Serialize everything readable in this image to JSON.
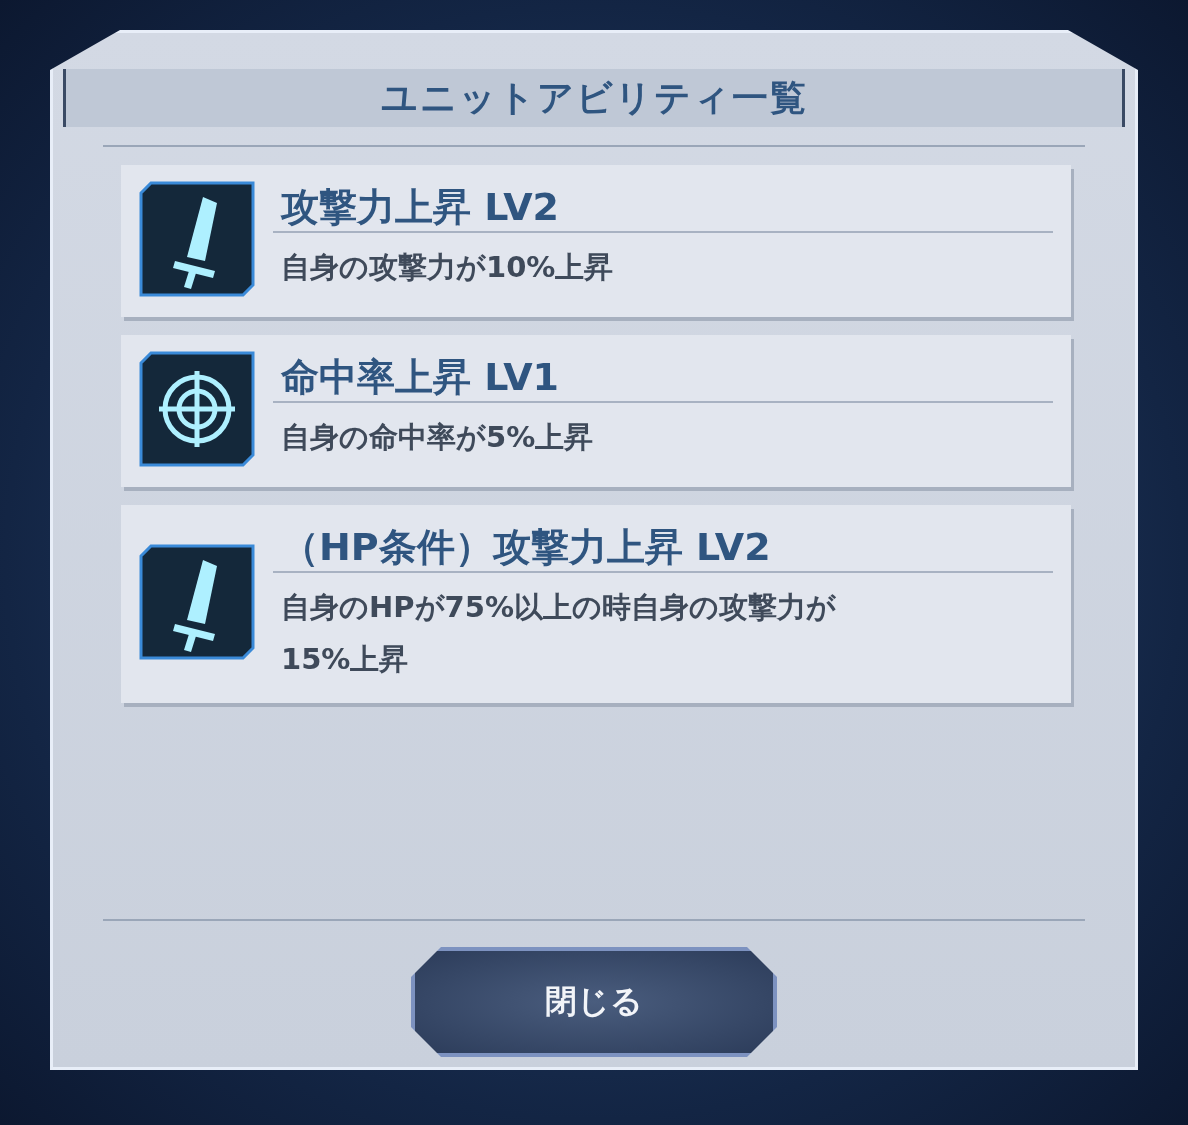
{
  "dialog": {
    "title": "ユニットアビリティ一覧"
  },
  "abilities": [
    {
      "kind": "sword",
      "name": "攻撃力上昇 LV2",
      "description": "自身の攻撃力が10%上昇"
    },
    {
      "kind": "target",
      "name": "命中率上昇 LV1",
      "description": "自身の命中率が5%上昇"
    },
    {
      "kind": "sword",
      "name": "（HP条件）攻撃力上昇 LV2",
      "description": "自身のHPが75%以上の時自身の攻撃力が\n15%上昇"
    }
  ],
  "close_button": {
    "label": "閉じる"
  }
}
